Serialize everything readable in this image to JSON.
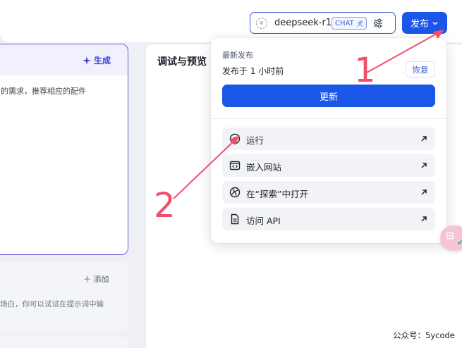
{
  "topbar": {
    "model_name": "deepseek-r1",
    "model_badge": "CHAT",
    "model_badge_glyph": "⽝",
    "publish_label": "发布"
  },
  "left_panel": {
    "generate_label": "生成",
    "description": "的需求，推荐相应的配件"
  },
  "left_card2": {
    "add_label": "添加",
    "tip": "场白，你可以试试在提示词中输"
  },
  "preview": {
    "title": "调试与预览"
  },
  "dropdown": {
    "latest_label": "最新发布",
    "published_time": "发布于 1 小时前",
    "restore_label": "恢复",
    "update_label": "更新",
    "items": [
      {
        "label": "运行",
        "icon": "play-circle-icon"
      },
      {
        "label": "嵌入网站",
        "icon": "embed-code-icon"
      },
      {
        "label": "在“探索”中打开",
        "icon": "explore-icon"
      },
      {
        "label": "访问 API",
        "icon": "document-icon"
      }
    ]
  },
  "annotations": {
    "number_1": "1",
    "number_2": "2",
    "color": "#f0506e"
  },
  "watermark": "公众号：5ycode",
  "colors": {
    "accent": "#1a56e8",
    "generate": "#3a3fd0"
  }
}
